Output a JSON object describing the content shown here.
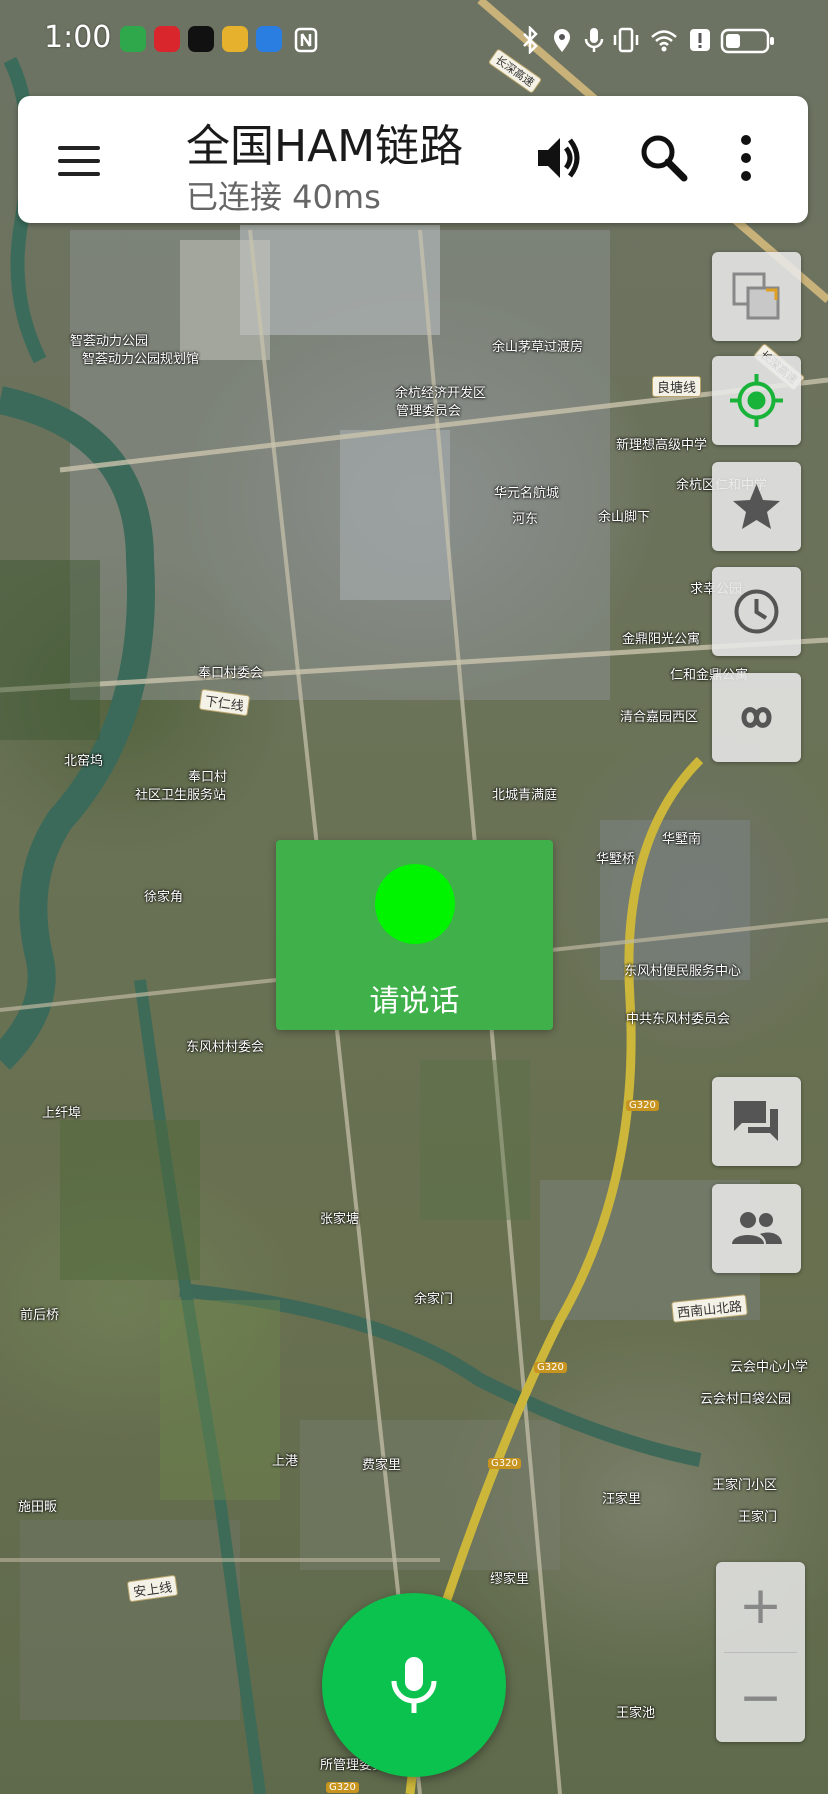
{
  "status_bar": {
    "time": "1:00",
    "icons": [
      "app-icon",
      "huawei-icon",
      "app-icon",
      "weibo-icon",
      "weather-icon",
      "nfc-icon",
      "bluetooth-icon",
      "location-icon",
      "mic-icon",
      "vibrate-icon",
      "wifi-icon",
      "alert-icon",
      "battery-icon"
    ]
  },
  "app_bar": {
    "title": "全国HAM链路",
    "subtitle": "已连接 40ms",
    "menu_icon": "menu-icon",
    "volume_icon": "volume-icon",
    "search_icon": "search-icon",
    "more_icon": "more-vert-icon"
  },
  "map_tools": [
    "layers-icon",
    "my-location-icon",
    "star-icon",
    "history-icon",
    "link-icon",
    "chat-icon",
    "people-icon"
  ],
  "speaking_card": {
    "label": "请说话",
    "indicator_color": "#00f400",
    "background": "#3fb04a"
  },
  "zoom": {
    "in": "+",
    "out": "−"
  },
  "ptt_button": {
    "icon": "mic-icon",
    "color": "#0cc24f"
  },
  "map_labels": [
    "智荟动力公园",
    "智荟动力公园规划馆",
    "余杭经济开发区",
    "管理委员会",
    "余山茅草过渡房",
    "良塘线",
    "新理想高级中学",
    "余杭区仁和中学",
    "华元名航城",
    "河东",
    "余山脚下",
    "求幸公园",
    "金鼎阳光公寓",
    "仁和金鼎公寓",
    "清合嘉园西区",
    "奉口村委会",
    "下仁线",
    "北窑坞",
    "奉口村",
    "社区卫生服务站",
    "北城青满庭",
    "华墅桥",
    "华墅南",
    "徐家角",
    "东风村便民服务中心",
    "中共东风村委员会",
    "东风村村委会",
    "上纤埠",
    "张家塘",
    "余家门",
    "前后桥",
    "西南山北路",
    "云会中心小学",
    "云会村口袋公园",
    "上港",
    "费家里",
    "汪家里",
    "王家门小区",
    "王家门",
    "施田畈",
    "安上线",
    "缪家里",
    "王家池",
    "所管理委员会"
  ],
  "road_shields": [
    "G320",
    "G320",
    "G320",
    "G320"
  ],
  "highway_labels": [
    "长深高速",
    "长深高速"
  ]
}
